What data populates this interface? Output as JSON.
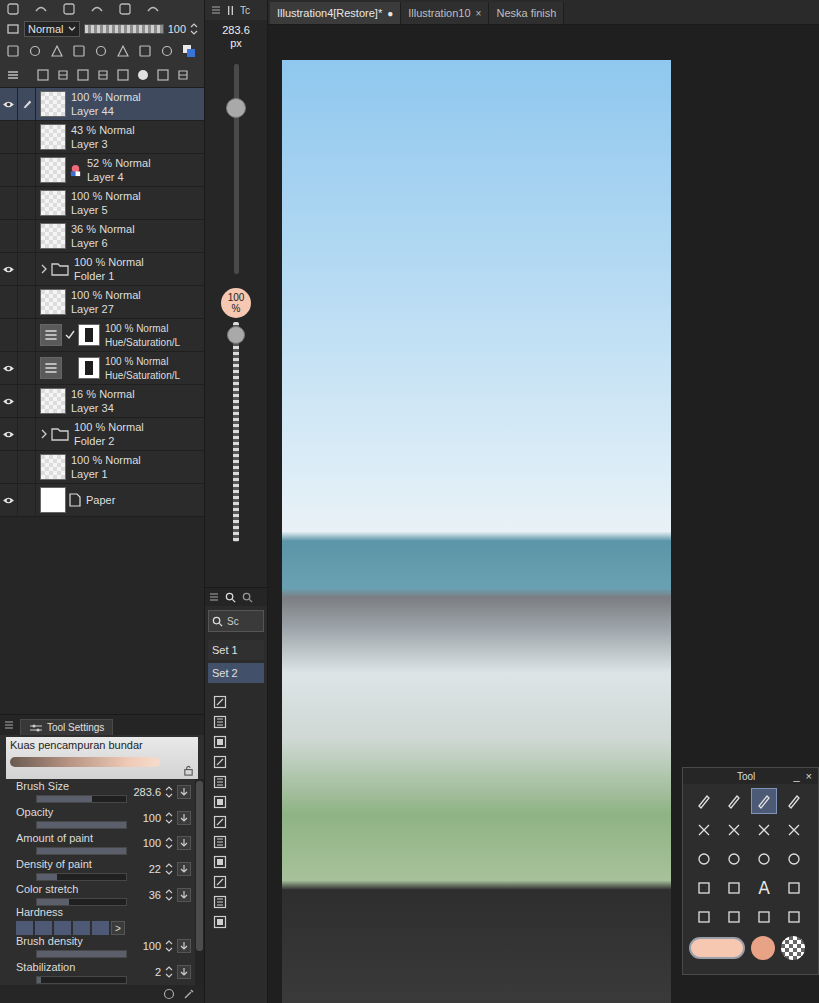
{
  "layer_panel": {
    "blend_mode": "Normal",
    "opacity": "100",
    "opacity_level": 1.0,
    "layers": [
      {
        "opacity": "100 %",
        "mode": "Normal",
        "name": "Layer 44",
        "kind": "raster",
        "visible": true,
        "editing": true,
        "selected": true
      },
      {
        "opacity": "43 %",
        "mode": "Normal",
        "name": "Layer 3",
        "kind": "raster",
        "visible": false,
        "editing": false,
        "selected": false
      },
      {
        "opacity": "52 %",
        "mode": "Normal",
        "name": "Layer 4",
        "kind": "palette",
        "visible": false,
        "editing": false,
        "selected": false
      },
      {
        "opacity": "100 %",
        "mode": "Normal",
        "name": "Layer 5",
        "kind": "raster",
        "visible": false,
        "editing": false,
        "selected": false
      },
      {
        "opacity": "36 %",
        "mode": "Normal",
        "name": "Layer 6",
        "kind": "raster",
        "visible": false,
        "editing": false,
        "selected": false
      },
      {
        "opacity": "100 %",
        "mode": "Normal",
        "name": "Folder 1",
        "kind": "folder",
        "visible": true,
        "editing": false,
        "selected": false,
        "expanded": false
      },
      {
        "opacity": "100 %",
        "mode": "Normal",
        "name": "Layer 27",
        "kind": "raster",
        "visible": false,
        "editing": false,
        "selected": false
      },
      {
        "opacity": "100 %",
        "mode": "Normal",
        "name": "Hue/Saturation/L",
        "kind": "adjustment",
        "visible": false,
        "editing": false,
        "selected": false,
        "checked": true
      },
      {
        "opacity": "100 %",
        "mode": "Normal",
        "name": "Hue/Saturation/L",
        "kind": "adjustment",
        "visible": true,
        "editing": false,
        "selected": false,
        "checked": false
      },
      {
        "opacity": "16 %",
        "mode": "Normal",
        "name": "Layer 34",
        "kind": "raster",
        "visible": true,
        "editing": false,
        "selected": false
      },
      {
        "opacity": "100 %",
        "mode": "Normal",
        "name": "Folder 2",
        "kind": "folder",
        "visible": true,
        "editing": false,
        "selected": false,
        "expanded": false
      },
      {
        "opacity": "100 %",
        "mode": "Normal",
        "name": "Layer 1",
        "kind": "raster",
        "visible": false,
        "editing": false,
        "selected": false
      },
      {
        "name": "Paper",
        "kind": "paper",
        "visible": true,
        "editing": false,
        "selected": false
      }
    ]
  },
  "side_tab": "Tc",
  "brush_size_slider": {
    "value": "283.6",
    "unit": "px",
    "level": 0.82
  },
  "opacity_slider": {
    "value": "100",
    "unit": "%",
    "level": 0.98
  },
  "sub_tool_panel": {
    "search_text": "Sc",
    "sets": [
      {
        "label": "Set 1",
        "selected": false
      },
      {
        "label": "Set 2",
        "selected": true
      }
    ]
  },
  "tool_settings": {
    "title": "Tool Settings",
    "brush_name": "Kuas pencampuran bundar",
    "params": [
      {
        "label": "Brush Size",
        "kind": "slider",
        "value": "283.6",
        "level": 0.62
      },
      {
        "label": "Opacity",
        "kind": "slider",
        "value": "100",
        "level": 1.0
      },
      {
        "label": "Amount of paint",
        "kind": "slider",
        "value": "100",
        "level": 1.0
      },
      {
        "label": "Density of paint",
        "kind": "slider",
        "value": "22",
        "level": 0.22
      },
      {
        "label": "Color stretch",
        "kind": "slider",
        "value": "36",
        "level": 0.36
      },
      {
        "label": "Hardness",
        "kind": "steps",
        "steps": 5,
        "more": ">"
      },
      {
        "label": "Brush density",
        "kind": "slider",
        "value": "100",
        "level": 1.0
      },
      {
        "label": "Stabilization",
        "kind": "slider",
        "value": "2",
        "level": 0.04
      }
    ]
  },
  "canvas_tabs": [
    {
      "label": "Illustration4[Restore]*",
      "mark": "●",
      "selected": true
    },
    {
      "label": "Illustration10",
      "mark": "×",
      "selected": false
    },
    {
      "label": "Neska finish",
      "mark": "",
      "selected": false
    }
  ],
  "tool_palette": {
    "title": "Tool",
    "minimize": "_",
    "close": "×",
    "text_tool": "A",
    "main_color": "#f6c8b2",
    "sub_color": "#e8a285"
  }
}
